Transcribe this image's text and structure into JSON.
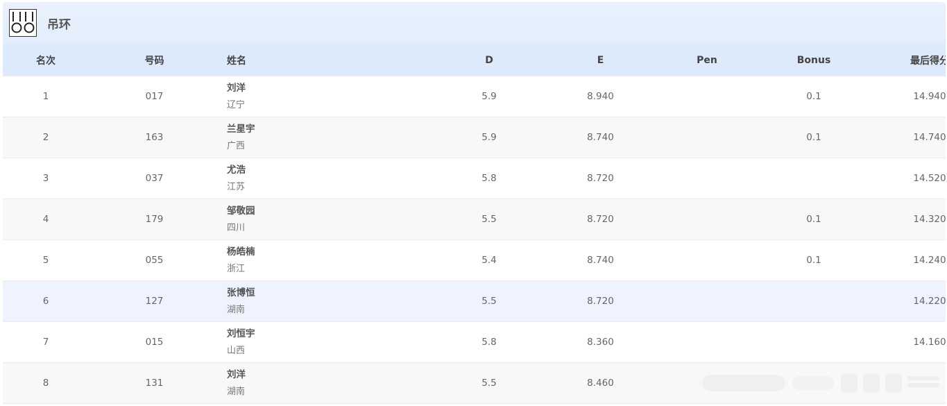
{
  "event": {
    "title": "吊环",
    "icon": "rings-icon"
  },
  "columns": {
    "rank": "名次",
    "number": "号码",
    "name": "姓名",
    "d": "D",
    "e": "E",
    "pen": "Pen",
    "bonus": "Bonus",
    "final": "最后得分"
  },
  "rows": [
    {
      "rank": "1",
      "number": "017",
      "name": "刘洋",
      "team": "辽宁",
      "d": "5.9",
      "e": "8.940",
      "pen": "",
      "bonus": "0.1",
      "final": "14.940"
    },
    {
      "rank": "2",
      "number": "163",
      "name": "兰星宇",
      "team": "广西",
      "d": "5.9",
      "e": "8.740",
      "pen": "",
      "bonus": "0.1",
      "final": "14.740"
    },
    {
      "rank": "3",
      "number": "037",
      "name": "尤浩",
      "team": "江苏",
      "d": "5.8",
      "e": "8.720",
      "pen": "",
      "bonus": "",
      "final": "14.520"
    },
    {
      "rank": "4",
      "number": "179",
      "name": "邹敬园",
      "team": "四川",
      "d": "5.5",
      "e": "8.720",
      "pen": "",
      "bonus": "0.1",
      "final": "14.320"
    },
    {
      "rank": "5",
      "number": "055",
      "name": "杨皓楠",
      "team": "浙江",
      "d": "5.4",
      "e": "8.740",
      "pen": "",
      "bonus": "0.1",
      "final": "14.240"
    },
    {
      "rank": "6",
      "number": "127",
      "name": "张博恒",
      "team": "湖南",
      "d": "5.5",
      "e": "8.720",
      "pen": "",
      "bonus": "",
      "final": "14.220"
    },
    {
      "rank": "7",
      "number": "015",
      "name": "刘恒宇",
      "team": "山西",
      "d": "5.8",
      "e": "8.360",
      "pen": "",
      "bonus": "",
      "final": "14.160"
    },
    {
      "rank": "8",
      "number": "131",
      "name": "刘洋",
      "team": "湖南",
      "d": "5.5",
      "e": "8.460",
      "pen": "",
      "bonus": "",
      "final": ""
    }
  ]
}
